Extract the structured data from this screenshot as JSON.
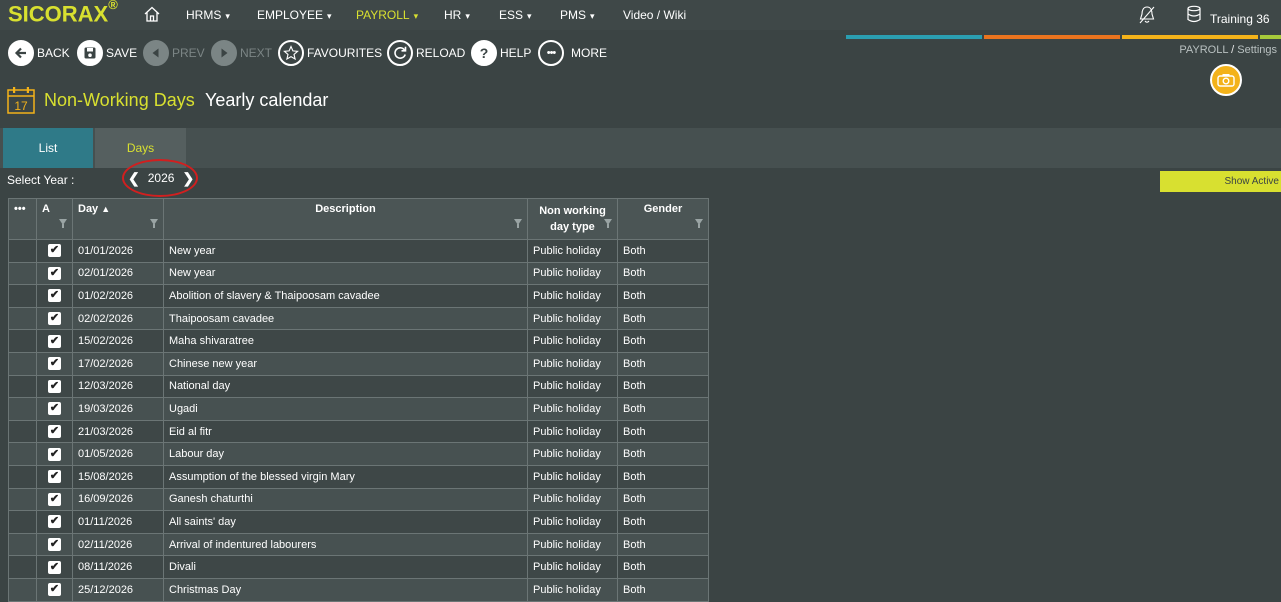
{
  "app": {
    "logo": "SICORAX",
    "logo_reg": "®"
  },
  "nav": {
    "items": [
      {
        "label": "HRMS",
        "caret": "▾"
      },
      {
        "label": "EMPLOYEE",
        "caret": "▾"
      },
      {
        "label": "PAYROLL",
        "caret": "▾"
      },
      {
        "label": "HR",
        "caret": "▾"
      },
      {
        "label": "ESS",
        "caret": "▾"
      },
      {
        "label": "PMS",
        "caret": "▾"
      },
      {
        "label": "Video / Wiki",
        "caret": ""
      }
    ],
    "active": "PAYROLL",
    "database": "Training 36"
  },
  "strip_colors": [
    "#2a9db0",
    "#e8731e",
    "#f3b21a",
    "#a6c93a"
  ],
  "toolbar": {
    "back": "BACK",
    "save": "SAVE",
    "prev": "PREV",
    "next": "NEXT",
    "favourites": "FAVOURITES",
    "reload": "RELOAD",
    "help": "HELP",
    "more": "MORE"
  },
  "breadcrumb": {
    "module": "PAYROLL",
    "sep": "/",
    "page": "Settings"
  },
  "page": {
    "calendar_day": "17",
    "title": "Non-Working Days",
    "subtitle": "Yearly calendar"
  },
  "tabs": {
    "list": "List",
    "days": "Days"
  },
  "year_selector": {
    "label": "Select Year :",
    "value": "2026",
    "show_active": "Show Active"
  },
  "table": {
    "headers": {
      "more": "•••",
      "active": "A",
      "day": "Day",
      "day_sort": "▲",
      "description": "Description",
      "type": "Non working day type",
      "gender": "Gender"
    },
    "rows": [
      {
        "day": "01/01/2026",
        "description": "New year",
        "type": "Public holiday",
        "gender": "Both",
        "active": true
      },
      {
        "day": "02/01/2026",
        "description": "New year",
        "type": "Public holiday",
        "gender": "Both",
        "active": true
      },
      {
        "day": "01/02/2026",
        "description": "Abolition of slavery & Thaipoosam cavadee",
        "type": "Public holiday",
        "gender": "Both",
        "active": true
      },
      {
        "day": "02/02/2026",
        "description": "Thaipoosam cavadee",
        "type": "Public holiday",
        "gender": "Both",
        "active": true
      },
      {
        "day": "15/02/2026",
        "description": "Maha shivaratree",
        "type": "Public holiday",
        "gender": "Both",
        "active": true
      },
      {
        "day": "17/02/2026",
        "description": "Chinese new year",
        "type": "Public holiday",
        "gender": "Both",
        "active": true
      },
      {
        "day": "12/03/2026",
        "description": "National day",
        "type": "Public holiday",
        "gender": "Both",
        "active": true
      },
      {
        "day": "19/03/2026",
        "description": "Ugadi",
        "type": "Public holiday",
        "gender": "Both",
        "active": true
      },
      {
        "day": "21/03/2026",
        "description": "Eid al fitr",
        "type": "Public holiday",
        "gender": "Both",
        "active": true
      },
      {
        "day": "01/05/2026",
        "description": "Labour day",
        "type": "Public holiday",
        "gender": "Both",
        "active": true
      },
      {
        "day": "15/08/2026",
        "description": "Assumption of the blessed virgin Mary",
        "type": "Public holiday",
        "gender": "Both",
        "active": true
      },
      {
        "day": "16/09/2026",
        "description": "Ganesh chaturthi",
        "type": "Public holiday",
        "gender": "Both",
        "active": true
      },
      {
        "day": "01/11/2026",
        "description": "All saints' day",
        "type": "Public holiday",
        "gender": "Both",
        "active": true
      },
      {
        "day": "02/11/2026",
        "description": "Arrival of indentured labourers",
        "type": "Public holiday",
        "gender": "Both",
        "active": true
      },
      {
        "day": "08/11/2026",
        "description": "Divali",
        "type": "Public holiday",
        "gender": "Both",
        "active": true
      },
      {
        "day": "25/12/2026",
        "description": "Christmas Day",
        "type": "Public holiday",
        "gender": "Both",
        "active": true
      }
    ]
  }
}
